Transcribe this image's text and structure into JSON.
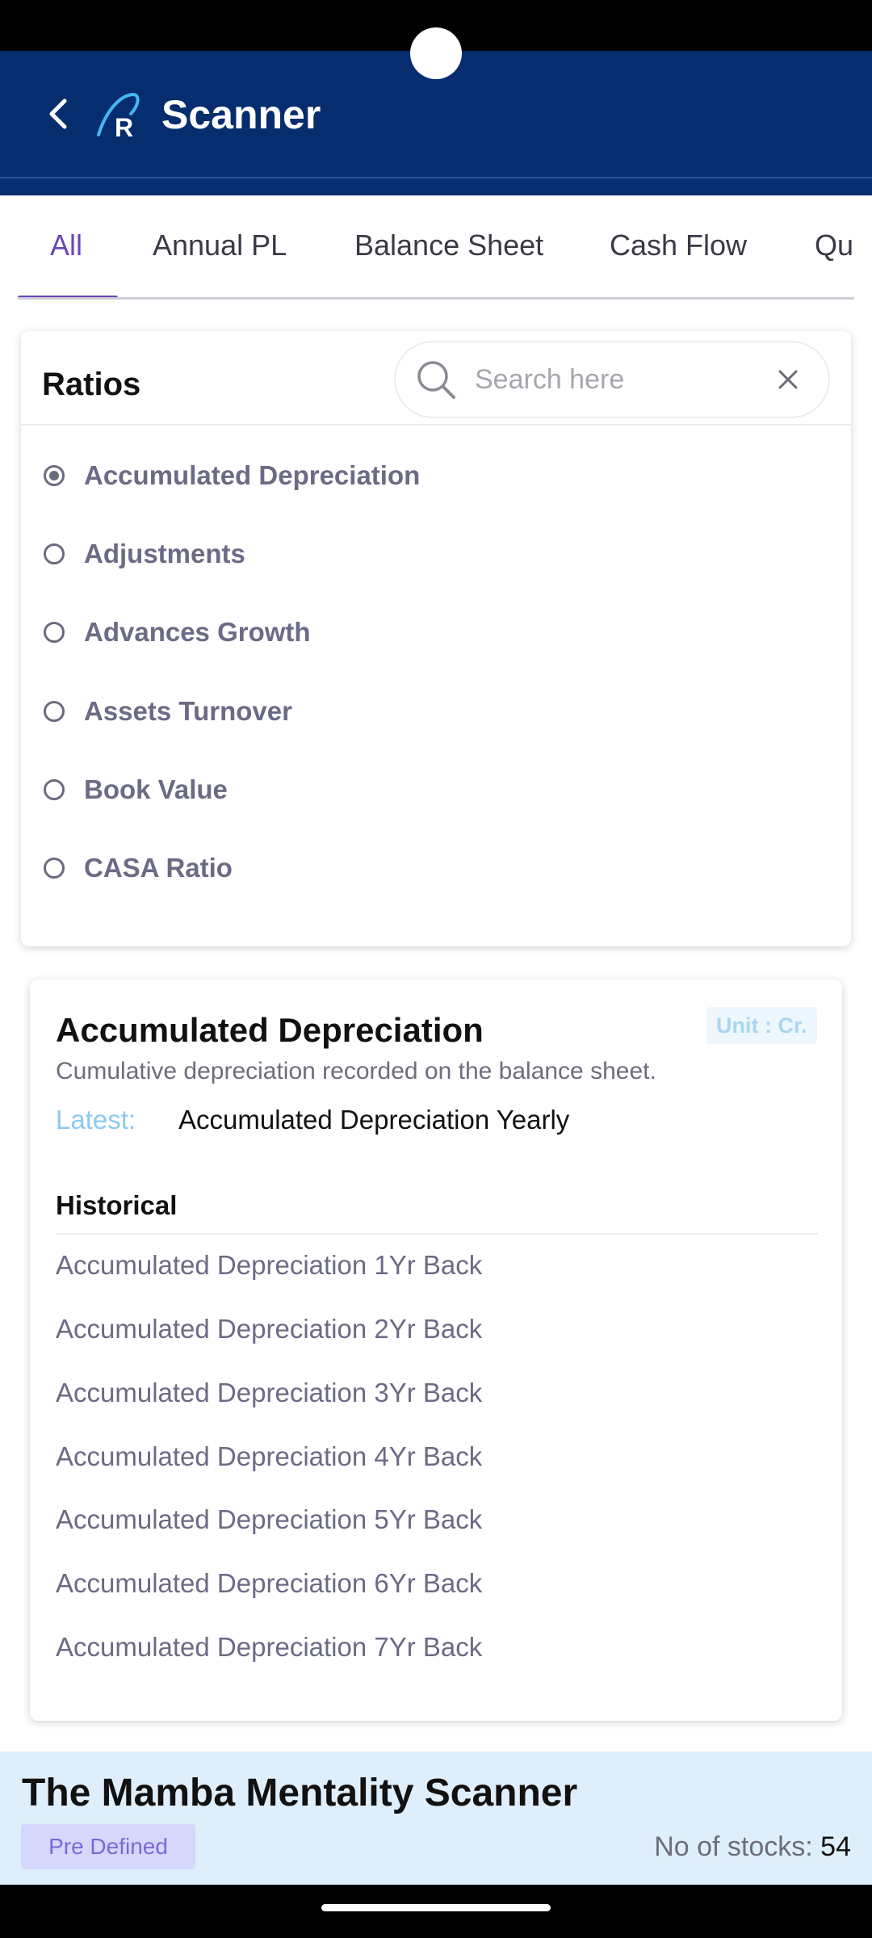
{
  "header": {
    "title": "Scanner"
  },
  "tabs": [
    {
      "label": "All"
    },
    {
      "label": "Annual PL"
    },
    {
      "label": "Balance Sheet"
    },
    {
      "label": "Cash Flow"
    },
    {
      "label": "Qua"
    }
  ],
  "ratios": {
    "title": "Ratios",
    "search_placeholder": "Search here",
    "items": [
      {
        "label": "Accumulated Depreciation",
        "selected": true
      },
      {
        "label": "Adjustments",
        "selected": false
      },
      {
        "label": "Advances Growth",
        "selected": false
      },
      {
        "label": "Assets Turnover",
        "selected": false
      },
      {
        "label": "Book Value",
        "selected": false
      },
      {
        "label": "CASA Ratio",
        "selected": false
      }
    ]
  },
  "detail": {
    "title": "Accumulated Depreciation",
    "unit": "Unit : Cr.",
    "description": "Cumulative depreciation recorded on the balance sheet.",
    "latest_label": "Latest:",
    "latest_value": "Accumulated Depreciation Yearly",
    "historical_title": "Historical",
    "historical_items": [
      "Accumulated Depreciation 1Yr Back",
      "Accumulated Depreciation 2Yr Back",
      "Accumulated Depreciation 3Yr Back",
      "Accumulated Depreciation 4Yr Back",
      "Accumulated Depreciation 5Yr Back",
      "Accumulated Depreciation 6Yr Back",
      "Accumulated Depreciation 7Yr Back"
    ]
  },
  "banner": {
    "scanner_name": "The Mamba Mentality Scanner",
    "badge": "Pre Defined",
    "stocks_label": "No of stocks:",
    "stocks_count": "54"
  },
  "colors": {
    "header_bg": "#062d6e",
    "accent": "#6a46b8",
    "banner_bg": "#dfeefb",
    "latest_label": "#8cc9ef"
  },
  "icons": [
    "back-arrow-icon",
    "app-logo-icon",
    "search-icon",
    "close-icon",
    "radio-icon"
  ]
}
